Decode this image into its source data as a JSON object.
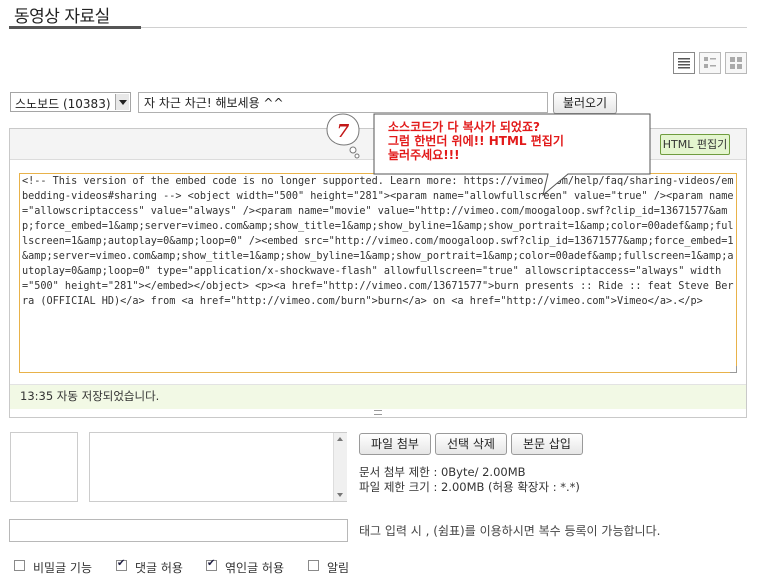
{
  "header": {
    "title": "동영상 자료실"
  },
  "view_toggles": [
    {
      "icon": "list-view-icon",
      "active": true
    },
    {
      "icon": "summary-view-icon",
      "active": false
    },
    {
      "icon": "grid-view-icon",
      "active": false
    }
  ],
  "post": {
    "category": "스노보드 (10383)",
    "title_value": "자 차근 차근! 해보세용 ^^",
    "load_button": "불러오기"
  },
  "editor": {
    "html_edit_button": "HTML 편집기",
    "content": "<!-- This version of the embed code is no longer supported. Learn more: https://vimeo.com/help/faq/sharing-videos/embedding-videos#sharing --> <object width=\"500\" height=\"281\"><param name=\"allowfullscreen\" value=\"true\" /><param name=\"allowscriptaccess\" value=\"always\" /><param name=\"movie\" value=\"http://vimeo.com/moogaloop.swf?clip_id=13671577&amp;force_embed=1&amp;server=vimeo.com&amp;show_title=1&amp;show_byline=1&amp;show_portrait=1&amp;color=00adef&amp;fullscreen=1&amp;autoplay=0&amp;loop=0\" /><embed src=\"http://vimeo.com/moogaloop.swf?clip_id=13671577&amp;force_embed=1&amp;server=vimeo.com&amp;show_title=1&amp;show_byline=1&amp;show_portrait=1&amp;color=00adef&amp;fullscreen=1&amp;autoplay=0&amp;loop=0\" type=\"application/x-shockwave-flash\" allowfullscreen=\"true\" allowscriptaccess=\"always\" width=\"500\" height=\"281\"></embed></object> <p><a href=\"http://vimeo.com/13671577\">burn presents :: Ride :: feat Steve Berra (OFFICIAL HD)</a> from <a href=\"http://vimeo.com/burn\">burn</a> on <a href=\"http://vimeo.com\">Vimeo</a>.</p>",
    "autosave_status": "13:35 자동 저장되었습니다."
  },
  "annotation": {
    "number": "7",
    "text": "소스코드가 다 복사가 되었죠?\n그럼 한번더 위에!! HTML 편집기\n눌러주세요!!!",
    "color": "#e21a1a"
  },
  "attachments": {
    "attach_button": "파일 첨부",
    "delete_button": "선택 삭제",
    "insert_button": "본문 삽입",
    "limit_line": "문서 첨부 제한 : 0Byte/ 2.00MB",
    "size_line": "파일 제한 크기 : 2.00MB (허용 확장자 : *.*)"
  },
  "tags": {
    "value": "",
    "help": "태그 입력 시 , (쉼표)를 이용하시면 복수 등록이 가능합니다."
  },
  "options": [
    {
      "label": "비밀글 기능",
      "checked": false
    },
    {
      "label": "댓글 허용",
      "checked": true
    },
    {
      "label": "엮인글 허용",
      "checked": true
    },
    {
      "label": "알림",
      "checked": false
    }
  ],
  "colors": {
    "accent_green": "#6f9c3e",
    "autosave_bg": "#f2f9e5",
    "focus_border": "#e8b24a"
  }
}
